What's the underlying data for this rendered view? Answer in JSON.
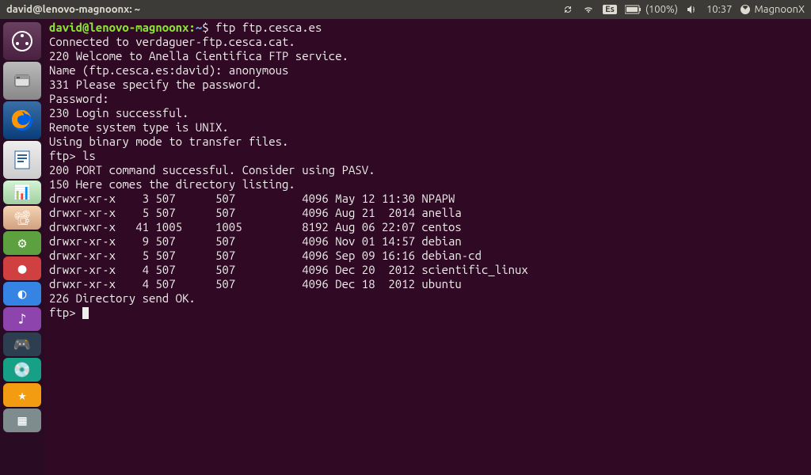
{
  "menubar": {
    "title": "david@lenovo-magnoonx: ~",
    "keyboard": "Es",
    "battery": "(100%)",
    "time": "10:37",
    "session": "MagnoonX"
  },
  "terminal": {
    "prompt_user": "david@lenovo-magnoonx",
    "prompt_path": "~",
    "cmd1": "ftp ftp.cesca.es",
    "line_connected": "Connected to verdaguer-ftp.cesca.cat.",
    "line_220": "220 Welcome to Anella Cientifica FTP service.",
    "line_name": "Name (ftp.cesca.es:david): anonymous",
    "line_331": "331 Please specify the password.",
    "line_password": "Password:",
    "line_230": "230 Login successful.",
    "line_systype": "Remote system type is UNIX.",
    "line_binary": "Using binary mode to transfer files.",
    "ftp_prompt": "ftp> ",
    "cmd_ls": "ls",
    "line_200": "200 PORT command successful. Consider using PASV.",
    "line_150": "150 Here comes the directory listing.",
    "listing": [
      "drwxr-xr-x    3 507      507          4096 May 12 11:30 NPAPW",
      "drwxr-xr-x    5 507      507          4096 Aug 21  2014 anella",
      "drwxrwxr-x   41 1005     1005         8192 Aug 06 22:07 centos",
      "drwxr-xr-x    9 507      507          4096 Nov 01 14:57 debian",
      "drwxr-xr-x    5 507      507          4096 Sep 09 16:16 debian-cd",
      "drwxr-xr-x    4 507      507          4096 Dec 20  2012 scientific_linux",
      "drwxr-xr-x    4 507      507          4096 Dec 18  2012 ubuntu"
    ],
    "line_226": "226 Directory send OK."
  },
  "launcher_colors": {
    "dash": "#dd4814",
    "files": "#a7a7a7",
    "firefox": "#0060df",
    "writer": "#2a6099",
    "calc": "#18a303",
    "impress": "#a33e03",
    "app1": "#5da03f",
    "app2": "#d04040",
    "app3": "#3584e4",
    "app4": "#8e44ad",
    "app5": "#2c3e50",
    "app6": "#16a085",
    "app7": "#f39c12",
    "app8": "#7f8c8d"
  }
}
